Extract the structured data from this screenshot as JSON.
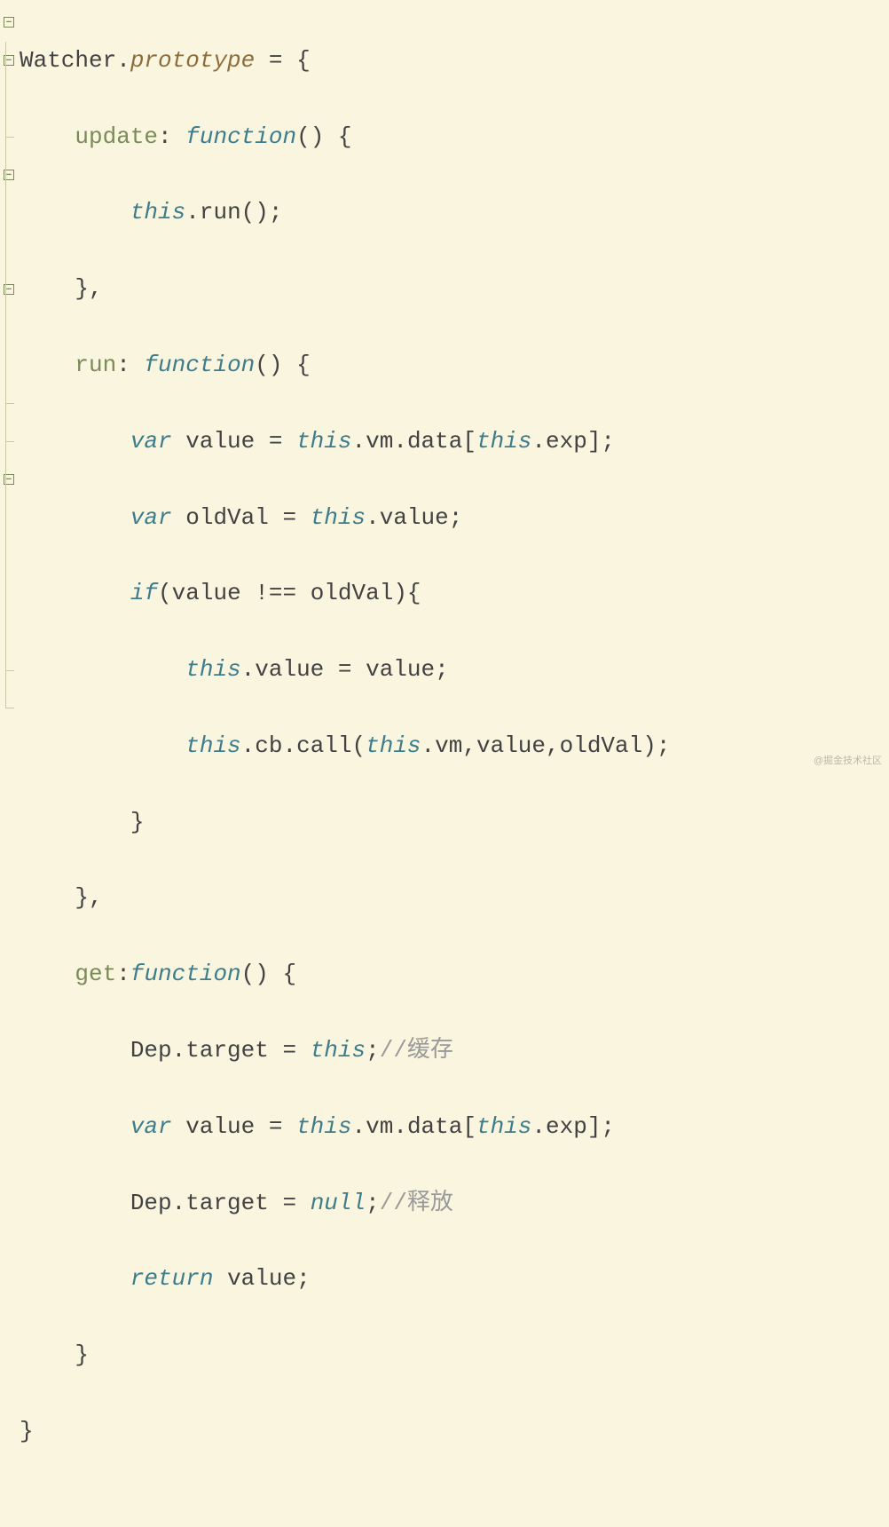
{
  "watermark": "@掘金技术社区",
  "code": {
    "l1": {
      "Watcher": "Watcher",
      "dot": ".",
      "prototype": "prototype",
      "eq": " = ",
      "brace": "{"
    },
    "l2": {
      "indent": "    ",
      "update": "update",
      "colon": ": ",
      "fn": "function",
      "paren": "() ",
      "brace": "{"
    },
    "l3": {
      "indent": "        ",
      "this": "this",
      "dot": ".",
      "run": "run",
      "call": "();"
    },
    "l4": {
      "indent": "    ",
      "close": "},"
    },
    "l5": {
      "indent": "    ",
      "run": "run",
      "colon": ": ",
      "fn": "function",
      "paren": "() ",
      "brace": "{"
    },
    "l6": {
      "indent": "        ",
      "var": "var",
      "sp": " ",
      "value": "value",
      "eq": " = ",
      "this": "this",
      "dot1": ".",
      "vm": "vm",
      "dot2": ".",
      "data": "data",
      "lb": "[",
      "this2": "this",
      "dot3": ".",
      "exp": "exp",
      "rb": "];"
    },
    "l7": {
      "indent": "        ",
      "var": "var",
      "sp": " ",
      "oldVal": "oldVal",
      "eq": " = ",
      "this": "this",
      "dot": ".",
      "value": "value",
      "semi": ";"
    },
    "l8": {
      "indent": "        ",
      "if": "if",
      "lp": "(",
      "value": "value",
      "neq": " !== ",
      "oldVal": "oldVal",
      "rp": ")",
      "brace": "{"
    },
    "l9": {
      "indent": "            ",
      "this": "this",
      "dot": ".",
      "value": "value",
      "eq": " = ",
      "value2": "value",
      "semi": ";"
    },
    "l10": {
      "indent": "            ",
      "this": "this",
      "dot": ".",
      "cb": "cb",
      "dot2": ".",
      "call": "call",
      "lp": "(",
      "this2": "this",
      "dot3": ".",
      "vm": "vm",
      "comma1": ",",
      "value": "value",
      "comma2": ",",
      "oldVal": "oldVal",
      "rp": ");"
    },
    "l11": {
      "indent": "        ",
      "close": "}"
    },
    "l12": {
      "indent": "    ",
      "close": "},"
    },
    "l13": {
      "indent": "    ",
      "get": "get",
      "colon": ":",
      "fn": "function",
      "paren": "() ",
      "brace": "{"
    },
    "l14": {
      "indent": "        ",
      "Dep": "Dep",
      "dot": ".",
      "target": "target",
      "eq": " = ",
      "this": "this",
      "semi": ";",
      "comment": "//缓存"
    },
    "l15": {
      "indent": "        ",
      "var": "var",
      "sp": " ",
      "value": "value",
      "eq": " = ",
      "this": "this",
      "dot1": ".",
      "vm": "vm",
      "dot2": ".",
      "data": "data",
      "lb": "[",
      "this2": "this",
      "dot3": ".",
      "exp": "exp",
      "rb": "];"
    },
    "l16": {
      "indent": "        ",
      "Dep": "Dep",
      "dot": ".",
      "target": "target",
      "eq": " = ",
      "null": "null",
      "semi": ";",
      "comment": "//释放"
    },
    "l17": {
      "indent": "        ",
      "return": "return",
      "sp": " ",
      "value": "value",
      "semi": ";"
    },
    "l18": {
      "indent": "    ",
      "close": "}"
    },
    "l19": {
      "close": "}"
    }
  }
}
